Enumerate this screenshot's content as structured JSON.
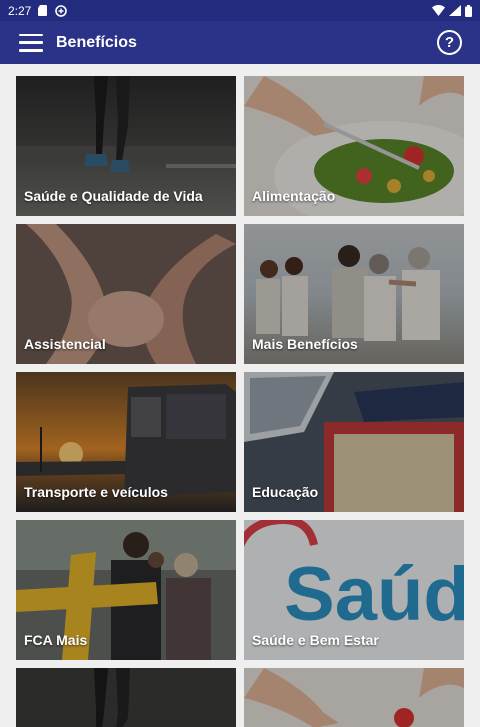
{
  "status_bar": {
    "time": "2:27"
  },
  "app_bar": {
    "title": "Benefícios",
    "help_icon": "?"
  },
  "cards": [
    {
      "label": "Saúde e Qualidade de Vida",
      "image": "running-legs"
    },
    {
      "label": "Alimentação",
      "image": "salad-plate"
    },
    {
      "label": "Assistencial",
      "image": "holding-hands"
    },
    {
      "label": "Mais Benefícios",
      "image": "family-at-beach"
    },
    {
      "label": "Transporte e veículos",
      "image": "bus-at-sunset"
    },
    {
      "label": "Educação",
      "image": "laptop-and-books"
    },
    {
      "label": "FCA Mais",
      "image": "people-with-yellow-cross"
    },
    {
      "label": "Saúde e Bem Estar",
      "image": "saude-logo",
      "logo_text": "Saúd"
    },
    {
      "label": "",
      "image": "running-legs"
    },
    {
      "label": "",
      "image": "salad-plate"
    }
  ],
  "colors": {
    "app_bar": "#2a3388",
    "status_bar": "#222b7e",
    "background": "#efefef"
  }
}
